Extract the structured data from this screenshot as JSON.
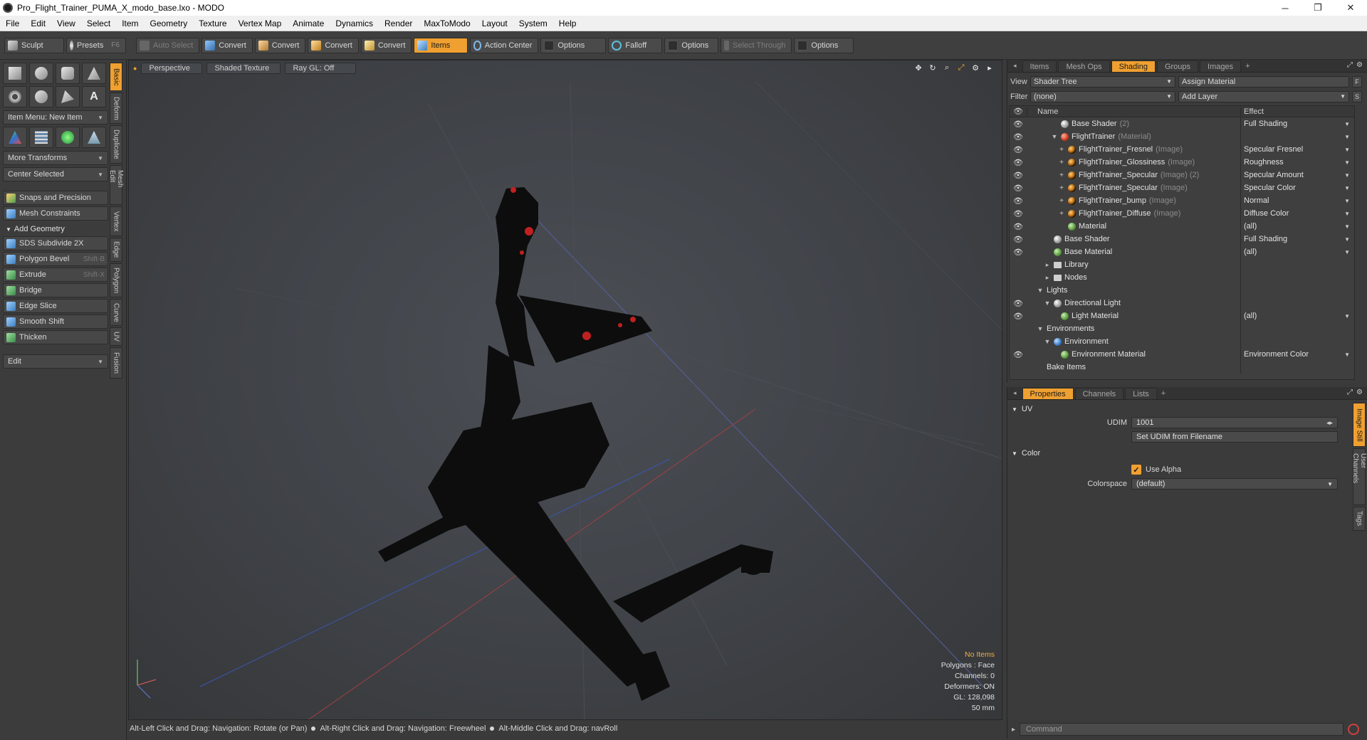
{
  "window": {
    "title": "Pro_Flight_Trainer_PUMA_X_modo_base.lxo - MODO",
    "minimize": "─",
    "maximize": "❐",
    "close": "✕"
  },
  "menu": [
    "File",
    "Edit",
    "View",
    "Select",
    "Item",
    "Geometry",
    "Texture",
    "Vertex Map",
    "Animate",
    "Dynamics",
    "Render",
    "MaxToModo",
    "Layout",
    "System",
    "Help"
  ],
  "toolbar": {
    "sculpt": "Sculpt",
    "presets": "Presets",
    "presets_key": "F6",
    "auto_select": "Auto Select",
    "convert1": "Convert",
    "convert2": "Convert",
    "convert3": "Convert",
    "convert4": "Convert",
    "items": "Items",
    "action_center": "Action Center",
    "options1": "Options",
    "falloff": "Falloff",
    "options2": "Options",
    "select_through": "Select Through",
    "options3": "Options"
  },
  "left_panel": {
    "item_menu": "Item Menu: New Item",
    "more_transforms": "More Transforms",
    "center_selected": "Center Selected",
    "snaps": "Snaps and Precision",
    "mesh_constraints": "Mesh Constraints",
    "add_geometry": "Add Geometry",
    "tools": [
      {
        "label": "SDS Subdivide 2X",
        "key": ""
      },
      {
        "label": "Polygon Bevel",
        "key": "Shift-B"
      },
      {
        "label": "Extrude",
        "key": "Shift-X"
      },
      {
        "label": "Bridge",
        "key": ""
      },
      {
        "label": "Edge Slice",
        "key": ""
      },
      {
        "label": "Smooth Shift",
        "key": ""
      },
      {
        "label": "Thicken",
        "key": ""
      }
    ],
    "edit_dropdown": "Edit",
    "vtabs": [
      "Basic",
      "Deform",
      "Duplicate",
      "Mesh Edit",
      "Vertex",
      "Edge",
      "Polygon",
      "Curve",
      "UV",
      "Fusion"
    ]
  },
  "viewport": {
    "view_mode": "Perspective",
    "shading": "Shaded Texture",
    "ray_gl": "Ray GL: Off",
    "info": {
      "items": "No Items",
      "polygons": "Polygons : Face",
      "channels": "Channels: 0",
      "deformers": "Deformers: ON",
      "gl": "GL: 128,098",
      "scale": "50 mm"
    }
  },
  "statusbar": {
    "hint1": "Alt-Left Click and Drag: Navigation: Rotate (or Pan)",
    "hint2": "Alt-Right Click and Drag: Navigation: Freewheel",
    "hint3": "Alt-Middle Click and Drag: navRoll"
  },
  "shading_panel": {
    "tabs": [
      "Items",
      "Mesh Ops",
      "Shading",
      "Groups",
      "Images"
    ],
    "active_tab": "Shading",
    "view_label": "View",
    "view_value": "Shader Tree",
    "assign_material": "Assign Material",
    "filter_label": "Filter",
    "filter_value": "(none)",
    "add_layer": "Add Layer",
    "f_btn": "F",
    "s_btn": "S",
    "col_name": "Name",
    "col_effect": "Effect",
    "rows": [
      {
        "name": "Base Shader",
        "suffix": "(2)",
        "effect": "Full Shading",
        "eye": true,
        "indent": 2,
        "icon": "grey",
        "exp": ""
      },
      {
        "name": "FlightTrainer",
        "suffix": "(Material)",
        "effect": "",
        "eye": true,
        "indent": 2,
        "icon": "red",
        "exp": "▼"
      },
      {
        "name": "FlightTrainer_Fresnel",
        "suffix": "(Image)",
        "effect": "Specular Fresnel",
        "eye": true,
        "indent": 3,
        "icon": "tex",
        "exp": "+"
      },
      {
        "name": "FlightTrainer_Glossiness",
        "suffix": "(Image)",
        "effect": "Roughness",
        "eye": true,
        "indent": 3,
        "icon": "tex",
        "exp": "+"
      },
      {
        "name": "FlightTrainer_Specular",
        "suffix": "(Image) (2)",
        "effect": "Specular Amount",
        "eye": true,
        "indent": 3,
        "icon": "tex",
        "exp": "+"
      },
      {
        "name": "FlightTrainer_Specular",
        "suffix": "(Image)",
        "effect": "Specular Color",
        "eye": true,
        "indent": 3,
        "icon": "tex",
        "exp": "+"
      },
      {
        "name": "FlightTrainer_bump",
        "suffix": "(Image)",
        "effect": "Normal",
        "eye": true,
        "indent": 3,
        "icon": "tex",
        "exp": "+"
      },
      {
        "name": "FlightTrainer_Diffuse",
        "suffix": "(Image)",
        "effect": "Diffuse Color",
        "eye": true,
        "indent": 3,
        "icon": "tex",
        "exp": "+"
      },
      {
        "name": "Material",
        "suffix": "",
        "effect": "(all)",
        "eye": true,
        "indent": 3,
        "icon": "green",
        "exp": ""
      },
      {
        "name": "Base Shader",
        "suffix": "",
        "effect": "Full Shading",
        "eye": true,
        "indent": 1,
        "icon": "grey",
        "exp": ""
      },
      {
        "name": "Base Material",
        "suffix": "",
        "effect": "(all)",
        "eye": true,
        "indent": 1,
        "icon": "green",
        "exp": ""
      },
      {
        "name": "Library",
        "suffix": "",
        "effect": "",
        "eye": false,
        "indent": 1,
        "icon": "folder",
        "exp": "▸"
      },
      {
        "name": "Nodes",
        "suffix": "",
        "effect": "",
        "eye": false,
        "indent": 1,
        "icon": "folder",
        "exp": "▸"
      },
      {
        "name": "Lights",
        "suffix": "",
        "effect": "",
        "eye": false,
        "indent": 0,
        "icon": "",
        "exp": "▼"
      },
      {
        "name": "Directional Light",
        "suffix": "",
        "effect": "",
        "eye": true,
        "indent": 1,
        "icon": "light",
        "exp": "▼"
      },
      {
        "name": "Light Material",
        "suffix": "",
        "effect": "(all)",
        "eye": true,
        "indent": 2,
        "icon": "green",
        "exp": ""
      },
      {
        "name": "Environments",
        "suffix": "",
        "effect": "",
        "eye": false,
        "indent": 0,
        "icon": "",
        "exp": "▼"
      },
      {
        "name": "Environment",
        "suffix": "",
        "effect": "",
        "eye": false,
        "indent": 1,
        "icon": "env",
        "exp": "▼"
      },
      {
        "name": "Environment Material",
        "suffix": "",
        "effect": "Environment Color",
        "eye": true,
        "indent": 2,
        "icon": "green",
        "exp": ""
      },
      {
        "name": "Bake Items",
        "suffix": "",
        "effect": "",
        "eye": false,
        "indent": 0,
        "icon": "",
        "exp": ""
      }
    ]
  },
  "properties_panel": {
    "tabs": [
      "Properties",
      "Channels",
      "Lists"
    ],
    "active_tab": "Properties",
    "uv_section": "UV",
    "udim_label": "UDIM",
    "udim_value": "1001",
    "set_udim": "Set UDIM from Filename",
    "color_section": "Color",
    "use_alpha": "Use Alpha",
    "colorspace_label": "Colorspace",
    "colorspace_value": "(default)",
    "vtabs": [
      "Image Still",
      "User Channels",
      "Tags"
    ]
  },
  "command": {
    "placeholder": "Command"
  }
}
